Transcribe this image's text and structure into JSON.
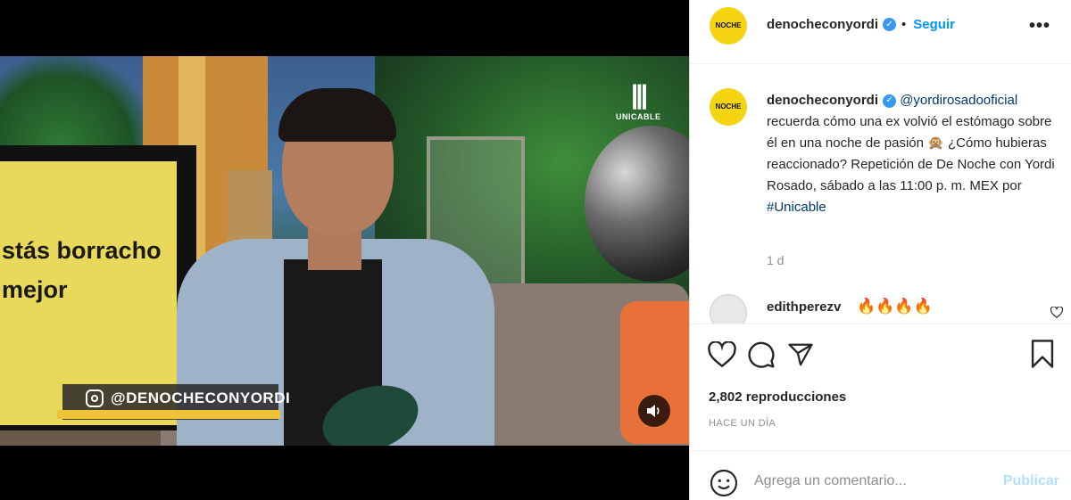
{
  "video": {
    "screen_text_line1": "stás borracho",
    "screen_text_line2": "mejor",
    "watermark_handle": "@DENOCHECONYORDI",
    "network_logo_text": "UNICABLE",
    "mute_icon": "speaker-icon"
  },
  "header": {
    "avatar_text_line1": "NOCHE",
    "username": "denocheconyordi",
    "verified_icon": "verified-badge-icon",
    "separator": "•",
    "follow_label": "Seguir",
    "more_label": "•••"
  },
  "caption": {
    "username": "denocheconyordi",
    "mention": "@yordirosadooficial",
    "text_part1": " recuerda cómo una ex volvió el estómago sobre él en una noche de pasión 🙊 ¿Cómo hubieras reaccionado? Repetición de De Noche con Yordi Rosado, sábado a las 11:00 p. m. MEX por ",
    "hashtag": "#Unicable",
    "time_ago": "1 d"
  },
  "comment": {
    "username": "edithperezv",
    "text": "🔥🔥🔥🔥"
  },
  "actions": {
    "views_count": "2,802",
    "views_label": "reproducciones",
    "date": "HACE UN DÍA"
  },
  "comment_box": {
    "placeholder": "Agrega un comentario...",
    "publish_label": "Publicar"
  },
  "colors": {
    "accent": "#0095f6",
    "publish_disabled": "#b2dffc",
    "verified": "#3897f0",
    "brand_yellow": "#f5d414"
  }
}
